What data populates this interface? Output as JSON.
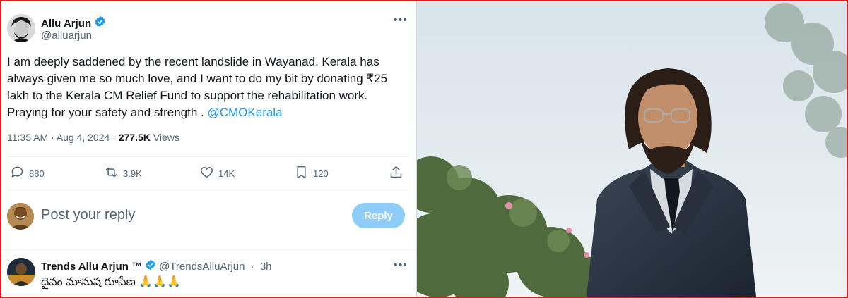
{
  "tweet": {
    "author_name": "Allu Arjun",
    "author_handle": "@alluarjun",
    "more_icon": "more-icon",
    "text_main": "I am deeply saddened by the recent landslide in Wayanad. Kerala has always given me so much love, and I want to do my bit by donating ₹25 lakh to the Kerala CM Relief Fund to support the rehabilitation work. Praying for your safety and strength . ",
    "mention": "@CMOKerala",
    "time": "11:35 AM · Aug 4, 2024 · ",
    "views_count": "277.5K",
    "views_label": " Views"
  },
  "actions": {
    "replies": "880",
    "reposts": "3.9K",
    "likes": "14K",
    "bookmarks": "120"
  },
  "reply_box": {
    "placeholder": "Post your reply",
    "button": "Reply"
  },
  "comment": {
    "name": "Trends Allu Arjun ™",
    "handle": "@TrendsAlluArjun",
    "separator": " · ",
    "time": "3h",
    "text": "దైవం మానుష రూపేణ 🙏🙏🙏"
  },
  "colors": {
    "accent": "#1d9bf0",
    "reply_button": "#8ecdf8",
    "frame_border": "#e31b23"
  }
}
